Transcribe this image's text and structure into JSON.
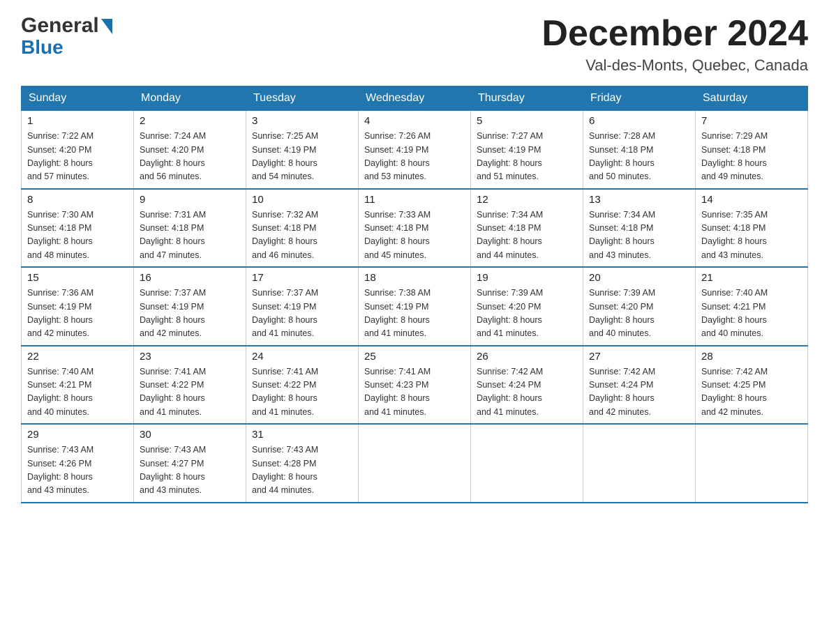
{
  "header": {
    "logo_general": "General",
    "logo_blue": "Blue",
    "month_title": "December 2024",
    "location": "Val-des-Monts, Quebec, Canada"
  },
  "days_of_week": [
    "Sunday",
    "Monday",
    "Tuesday",
    "Wednesday",
    "Thursday",
    "Friday",
    "Saturday"
  ],
  "weeks": [
    [
      {
        "num": "1",
        "sunrise": "Sunrise: 7:22 AM",
        "sunset": "Sunset: 4:20 PM",
        "daylight": "Daylight: 8 hours",
        "daylight2": "and 57 minutes."
      },
      {
        "num": "2",
        "sunrise": "Sunrise: 7:24 AM",
        "sunset": "Sunset: 4:20 PM",
        "daylight": "Daylight: 8 hours",
        "daylight2": "and 56 minutes."
      },
      {
        "num": "3",
        "sunrise": "Sunrise: 7:25 AM",
        "sunset": "Sunset: 4:19 PM",
        "daylight": "Daylight: 8 hours",
        "daylight2": "and 54 minutes."
      },
      {
        "num": "4",
        "sunrise": "Sunrise: 7:26 AM",
        "sunset": "Sunset: 4:19 PM",
        "daylight": "Daylight: 8 hours",
        "daylight2": "and 53 minutes."
      },
      {
        "num": "5",
        "sunrise": "Sunrise: 7:27 AM",
        "sunset": "Sunset: 4:19 PM",
        "daylight": "Daylight: 8 hours",
        "daylight2": "and 51 minutes."
      },
      {
        "num": "6",
        "sunrise": "Sunrise: 7:28 AM",
        "sunset": "Sunset: 4:18 PM",
        "daylight": "Daylight: 8 hours",
        "daylight2": "and 50 minutes."
      },
      {
        "num": "7",
        "sunrise": "Sunrise: 7:29 AM",
        "sunset": "Sunset: 4:18 PM",
        "daylight": "Daylight: 8 hours",
        "daylight2": "and 49 minutes."
      }
    ],
    [
      {
        "num": "8",
        "sunrise": "Sunrise: 7:30 AM",
        "sunset": "Sunset: 4:18 PM",
        "daylight": "Daylight: 8 hours",
        "daylight2": "and 48 minutes."
      },
      {
        "num": "9",
        "sunrise": "Sunrise: 7:31 AM",
        "sunset": "Sunset: 4:18 PM",
        "daylight": "Daylight: 8 hours",
        "daylight2": "and 47 minutes."
      },
      {
        "num": "10",
        "sunrise": "Sunrise: 7:32 AM",
        "sunset": "Sunset: 4:18 PM",
        "daylight": "Daylight: 8 hours",
        "daylight2": "and 46 minutes."
      },
      {
        "num": "11",
        "sunrise": "Sunrise: 7:33 AM",
        "sunset": "Sunset: 4:18 PM",
        "daylight": "Daylight: 8 hours",
        "daylight2": "and 45 minutes."
      },
      {
        "num": "12",
        "sunrise": "Sunrise: 7:34 AM",
        "sunset": "Sunset: 4:18 PM",
        "daylight": "Daylight: 8 hours",
        "daylight2": "and 44 minutes."
      },
      {
        "num": "13",
        "sunrise": "Sunrise: 7:34 AM",
        "sunset": "Sunset: 4:18 PM",
        "daylight": "Daylight: 8 hours",
        "daylight2": "and 43 minutes."
      },
      {
        "num": "14",
        "sunrise": "Sunrise: 7:35 AM",
        "sunset": "Sunset: 4:18 PM",
        "daylight": "Daylight: 8 hours",
        "daylight2": "and 43 minutes."
      }
    ],
    [
      {
        "num": "15",
        "sunrise": "Sunrise: 7:36 AM",
        "sunset": "Sunset: 4:19 PM",
        "daylight": "Daylight: 8 hours",
        "daylight2": "and 42 minutes."
      },
      {
        "num": "16",
        "sunrise": "Sunrise: 7:37 AM",
        "sunset": "Sunset: 4:19 PM",
        "daylight": "Daylight: 8 hours",
        "daylight2": "and 42 minutes."
      },
      {
        "num": "17",
        "sunrise": "Sunrise: 7:37 AM",
        "sunset": "Sunset: 4:19 PM",
        "daylight": "Daylight: 8 hours",
        "daylight2": "and 41 minutes."
      },
      {
        "num": "18",
        "sunrise": "Sunrise: 7:38 AM",
        "sunset": "Sunset: 4:19 PM",
        "daylight": "Daylight: 8 hours",
        "daylight2": "and 41 minutes."
      },
      {
        "num": "19",
        "sunrise": "Sunrise: 7:39 AM",
        "sunset": "Sunset: 4:20 PM",
        "daylight": "Daylight: 8 hours",
        "daylight2": "and 41 minutes."
      },
      {
        "num": "20",
        "sunrise": "Sunrise: 7:39 AM",
        "sunset": "Sunset: 4:20 PM",
        "daylight": "Daylight: 8 hours",
        "daylight2": "and 40 minutes."
      },
      {
        "num": "21",
        "sunrise": "Sunrise: 7:40 AM",
        "sunset": "Sunset: 4:21 PM",
        "daylight": "Daylight: 8 hours",
        "daylight2": "and 40 minutes."
      }
    ],
    [
      {
        "num": "22",
        "sunrise": "Sunrise: 7:40 AM",
        "sunset": "Sunset: 4:21 PM",
        "daylight": "Daylight: 8 hours",
        "daylight2": "and 40 minutes."
      },
      {
        "num": "23",
        "sunrise": "Sunrise: 7:41 AM",
        "sunset": "Sunset: 4:22 PM",
        "daylight": "Daylight: 8 hours",
        "daylight2": "and 41 minutes."
      },
      {
        "num": "24",
        "sunrise": "Sunrise: 7:41 AM",
        "sunset": "Sunset: 4:22 PM",
        "daylight": "Daylight: 8 hours",
        "daylight2": "and 41 minutes."
      },
      {
        "num": "25",
        "sunrise": "Sunrise: 7:41 AM",
        "sunset": "Sunset: 4:23 PM",
        "daylight": "Daylight: 8 hours",
        "daylight2": "and 41 minutes."
      },
      {
        "num": "26",
        "sunrise": "Sunrise: 7:42 AM",
        "sunset": "Sunset: 4:24 PM",
        "daylight": "Daylight: 8 hours",
        "daylight2": "and 41 minutes."
      },
      {
        "num": "27",
        "sunrise": "Sunrise: 7:42 AM",
        "sunset": "Sunset: 4:24 PM",
        "daylight": "Daylight: 8 hours",
        "daylight2": "and 42 minutes."
      },
      {
        "num": "28",
        "sunrise": "Sunrise: 7:42 AM",
        "sunset": "Sunset: 4:25 PM",
        "daylight": "Daylight: 8 hours",
        "daylight2": "and 42 minutes."
      }
    ],
    [
      {
        "num": "29",
        "sunrise": "Sunrise: 7:43 AM",
        "sunset": "Sunset: 4:26 PM",
        "daylight": "Daylight: 8 hours",
        "daylight2": "and 43 minutes."
      },
      {
        "num": "30",
        "sunrise": "Sunrise: 7:43 AM",
        "sunset": "Sunset: 4:27 PM",
        "daylight": "Daylight: 8 hours",
        "daylight2": "and 43 minutes."
      },
      {
        "num": "31",
        "sunrise": "Sunrise: 7:43 AM",
        "sunset": "Sunset: 4:28 PM",
        "daylight": "Daylight: 8 hours",
        "daylight2": "and 44 minutes."
      },
      null,
      null,
      null,
      null
    ]
  ]
}
